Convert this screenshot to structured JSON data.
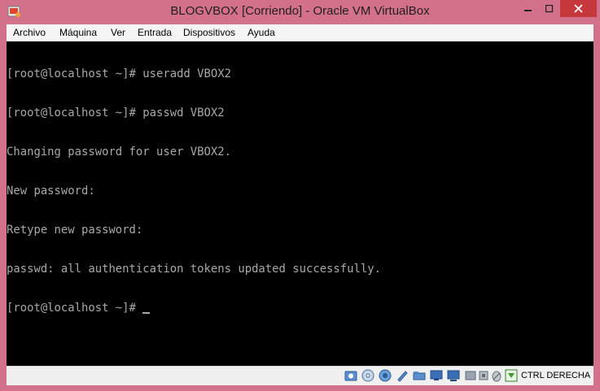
{
  "window": {
    "title": "BLOGVBOX [Corriendo] - Oracle VM VirtualBox",
    "accent_color": "#d3708a",
    "close_color": "#c7383c"
  },
  "menu": {
    "items": [
      {
        "label": "Archivo"
      },
      {
        "label": "Máquina"
      },
      {
        "label": "Ver"
      },
      {
        "label": "Entrada"
      },
      {
        "label": "Dispositivos"
      },
      {
        "label": "Ayuda"
      }
    ]
  },
  "terminal": {
    "lines": [
      "[root@localhost ~]# useradd VBOX2",
      "[root@localhost ~]# passwd VBOX2",
      "Changing password for user VBOX2.",
      "New password:",
      "Retype new password:",
      "passwd: all authentication tokens updated successfully."
    ],
    "prompt": "[root@localhost ~]# "
  },
  "statusbar": {
    "icons": [
      "hard-disk-icon",
      "optical-drive-icon",
      "audio-icon",
      "network-icon",
      "usb-icon",
      "shared-folders-icon",
      "display-icon",
      "video-capture-icon",
      "cpu-icon",
      "mouse-integration-icon",
      "keyboard-capture-icon"
    ],
    "host_key": "CTRL DERECHA"
  }
}
